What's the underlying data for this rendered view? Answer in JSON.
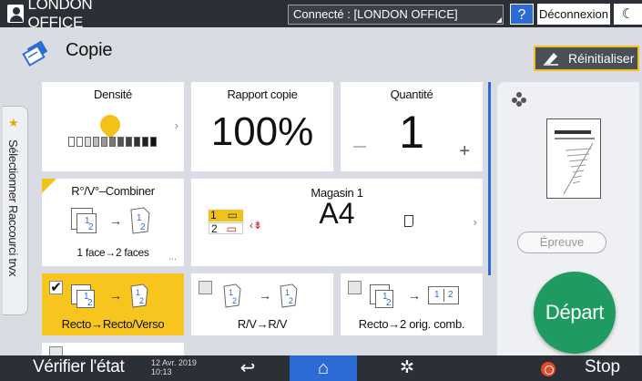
{
  "topbar": {
    "user": "LONDON OFFICE",
    "connection": "Connecté : [LONDON OFFICE]",
    "help_label": "?",
    "logout_label": "Déconnexion",
    "moon_label": "☾"
  },
  "header": {
    "title": "Copie",
    "reset_label": "Réinitialiser"
  },
  "side_tab": {
    "label": "Sélectionner Raccourci trvx"
  },
  "tiles": {
    "density": {
      "label": "Densité",
      "level_fraction": 0.55
    },
    "ratio": {
      "label": "Rapport copie",
      "value": "100%"
    },
    "quantity": {
      "label": "Quantité",
      "value": "1"
    },
    "combine": {
      "label": "R°/V°–Combiner",
      "sub": "1 face→2 faces",
      "more": "..."
    },
    "tray": {
      "label": "Magasin 1",
      "paper": "A4",
      "rows": [
        "1",
        "2"
      ]
    },
    "opt1": {
      "label": "Recto→Recto/Verso",
      "checked": true
    },
    "opt2": {
      "label": "R/V→R/V",
      "checked": false
    },
    "opt3": {
      "label": "Recto→2 orig. comb.",
      "checked": false
    }
  },
  "right_panel": {
    "proof_label": "Épreuve",
    "start_label": "Départ"
  },
  "bottombar": {
    "status_label": "Vérifier l'état",
    "date": "12 Avr. 2019",
    "time": "10:13",
    "stop_label": "Stop"
  },
  "colors": {
    "accent_yellow": "#f2c21a",
    "start_green": "#1f9b5f",
    "home_blue": "#2d6bd4"
  }
}
